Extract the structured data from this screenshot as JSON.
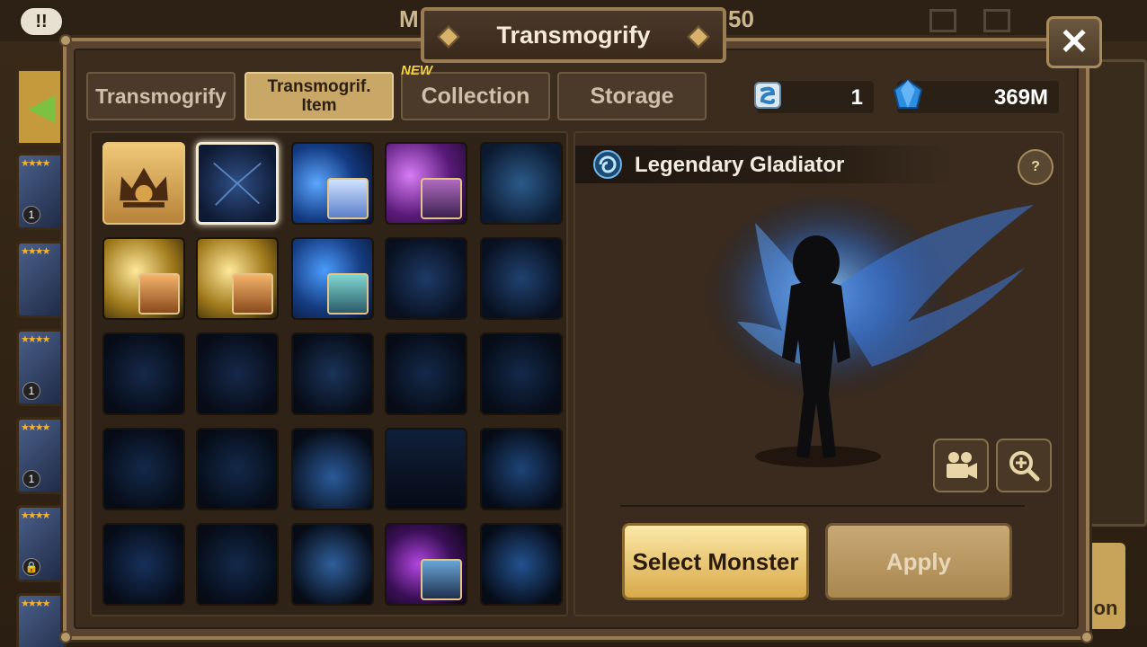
{
  "background": {
    "title_left": "M",
    "title_right": "50",
    "chat_label": "!!",
    "right_button_label": "on",
    "side_cards": [
      {
        "stars": "★★★★",
        "level": "1"
      },
      {
        "stars": "★★★★",
        "level": ""
      },
      {
        "stars": "★★★★",
        "level": "1"
      },
      {
        "stars": "★★★★",
        "level": "1"
      },
      {
        "stars": "★★★★",
        "level": "🔒"
      },
      {
        "stars": "★★★★",
        "level": ""
      }
    ]
  },
  "modal": {
    "title": "Transmogrify",
    "close_label": "✕"
  },
  "tabs": [
    {
      "label": "Transmogrify",
      "active": false
    },
    {
      "label": "Transmogrif. Item",
      "active": true
    },
    {
      "label": "Collection",
      "active": false,
      "badge": "NEW"
    },
    {
      "label": "Storage",
      "active": false
    }
  ],
  "currency": {
    "scroll_count": "1",
    "crystal_amount": "369M"
  },
  "detail": {
    "name": "Legendary Gladiator",
    "help_label": "?",
    "select_label": "Select Monster",
    "apply_label": "Apply"
  },
  "grid": [
    [
      "special-frame",
      "selected-blue",
      "blue-portrait",
      "purple-portrait",
      "blue"
    ],
    [
      "gold-portrait",
      "gold-portrait",
      "blue-portrait2",
      "dark",
      "dark"
    ],
    [
      "dark",
      "dark",
      "dark",
      "dark",
      "dark"
    ],
    [
      "dark",
      "dark",
      "dark",
      "dark",
      "dark"
    ],
    [
      "dark",
      "dark",
      "dark",
      "purple-portrait2",
      "dark"
    ]
  ]
}
